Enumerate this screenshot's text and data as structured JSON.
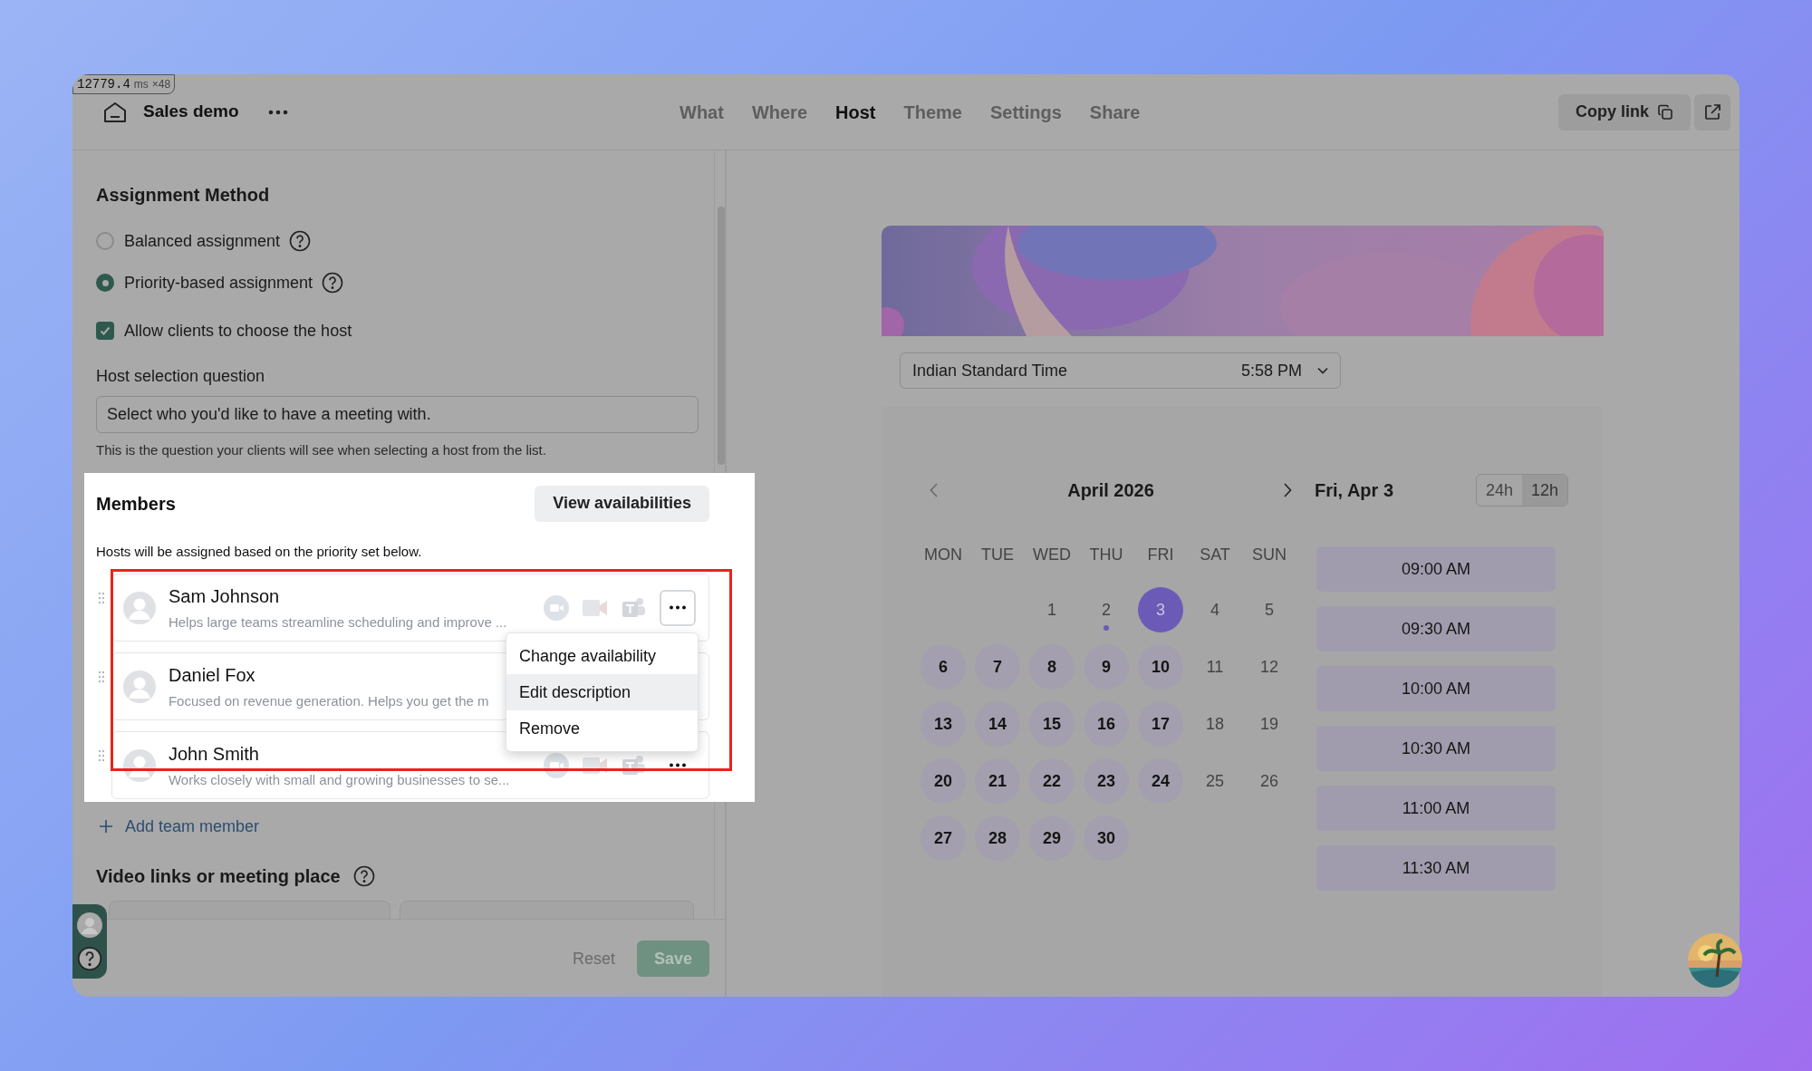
{
  "debug_badge": {
    "value": "12779.4",
    "unit": "ms",
    "count": "×48"
  },
  "header": {
    "title": "Sales demo"
  },
  "tabs": [
    {
      "label": "What",
      "selected": false
    },
    {
      "label": "Where",
      "selected": false
    },
    {
      "label": "Host",
      "selected": true
    },
    {
      "label": "Theme",
      "selected": false
    },
    {
      "label": "Settings",
      "selected": false
    },
    {
      "label": "Share",
      "selected": false
    }
  ],
  "copy_link": "Copy link",
  "assignment": {
    "title": "Assignment Method",
    "options": [
      {
        "label": "Balanced assignment",
        "selected": false
      },
      {
        "label": "Priority-based assignment",
        "selected": true
      }
    ],
    "allow_choose": {
      "label": "Allow clients to choose the host",
      "checked": true
    },
    "question_label": "Host selection question",
    "question_value": "Select who you'd like to have a meeting with.",
    "question_help": "This is the question your clients will see when selecting a host from the list."
  },
  "members": {
    "title": "Members",
    "view_button": "View availabilities",
    "hint": "Hosts will be assigned based on the priority set below.",
    "items": [
      {
        "name": "Sam Johnson",
        "description": "Helps large teams streamline scheduling and improve ...",
        "menu_open": true
      },
      {
        "name": "Daniel Fox",
        "description": "Focused on revenue generation. Helps you get the m",
        "menu_open": false
      },
      {
        "name": "John Smith",
        "description": "Works closely with small and growing businesses to se...",
        "menu_open": false
      }
    ],
    "menu": [
      {
        "label": "Change availability",
        "selected": false
      },
      {
        "label": "Edit description",
        "selected": true
      },
      {
        "label": "Remove",
        "selected": false
      }
    ]
  },
  "add_member": "Add team member",
  "video_section": {
    "title": "Video links or meeting place"
  },
  "footer": {
    "reset": "Reset",
    "save": "Save"
  },
  "booking": {
    "timezone": "Indian Standard Time",
    "current_time": "5:58 PM",
    "month": "April 2026",
    "date": "Fri, Apr 3",
    "formats": [
      {
        "label": "24h",
        "selected": false
      },
      {
        "label": "12h",
        "selected": true
      }
    ],
    "weekdays": [
      "MON",
      "TUE",
      "WED",
      "THU",
      "FRI",
      "SAT",
      "SUN"
    ],
    "weeks": [
      [
        {
          "label": "1",
          "available": false,
          "selected": false,
          "marked": false
        },
        {
          "label": "2",
          "available": false,
          "selected": false,
          "marked": true
        },
        {
          "label": "3",
          "available": true,
          "selected": true,
          "marked": false
        },
        {
          "label": "4",
          "available": false,
          "selected": false,
          "marked": false
        },
        {
          "label": "5",
          "available": false,
          "selected": false,
          "marked": false
        }
      ],
      [
        {
          "label": "6",
          "available": true,
          "selected": false,
          "marked": false
        },
        {
          "label": "7",
          "available": true,
          "selected": false,
          "marked": false
        },
        {
          "label": "8",
          "available": true,
          "selected": false,
          "marked": false
        },
        {
          "label": "9",
          "available": true,
          "selected": false,
          "marked": false
        },
        {
          "label": "10",
          "available": true,
          "selected": false,
          "marked": false
        },
        {
          "label": "11",
          "available": false,
          "selected": false,
          "marked": false
        },
        {
          "label": "12",
          "available": false,
          "selected": false,
          "marked": false
        }
      ],
      [
        {
          "label": "13",
          "available": true,
          "selected": false,
          "marked": false
        },
        {
          "label": "14",
          "available": true,
          "selected": false,
          "marked": false
        },
        {
          "label": "15",
          "available": true,
          "selected": false,
          "marked": false
        },
        {
          "label": "16",
          "available": true,
          "selected": false,
          "marked": false
        },
        {
          "label": "17",
          "available": true,
          "selected": false,
          "marked": false
        },
        {
          "label": "18",
          "available": false,
          "selected": false,
          "marked": false
        },
        {
          "label": "19",
          "available": false,
          "selected": false,
          "marked": false
        }
      ],
      [
        {
          "label": "20",
          "available": true,
          "selected": false,
          "marked": false
        },
        {
          "label": "21",
          "available": true,
          "selected": false,
          "marked": false
        },
        {
          "label": "22",
          "available": true,
          "selected": false,
          "marked": false
        },
        {
          "label": "23",
          "available": true,
          "selected": false,
          "marked": false
        },
        {
          "label": "24",
          "available": true,
          "selected": false,
          "marked": false
        },
        {
          "label": "25",
          "available": false,
          "selected": false,
          "marked": false
        },
        {
          "label": "26",
          "available": false,
          "selected": false,
          "marked": false
        }
      ],
      [
        {
          "label": "27",
          "available": true,
          "selected": false,
          "marked": false
        },
        {
          "label": "28",
          "available": true,
          "selected": false,
          "marked": false
        },
        {
          "label": "29",
          "available": true,
          "selected": false,
          "marked": false
        },
        {
          "label": "30",
          "available": true,
          "selected": false,
          "marked": false
        }
      ]
    ],
    "times": [
      "09:00 AM",
      "09:30 AM",
      "10:00 AM",
      "10:30 AM",
      "11:00 AM",
      "11:30 AM"
    ]
  }
}
